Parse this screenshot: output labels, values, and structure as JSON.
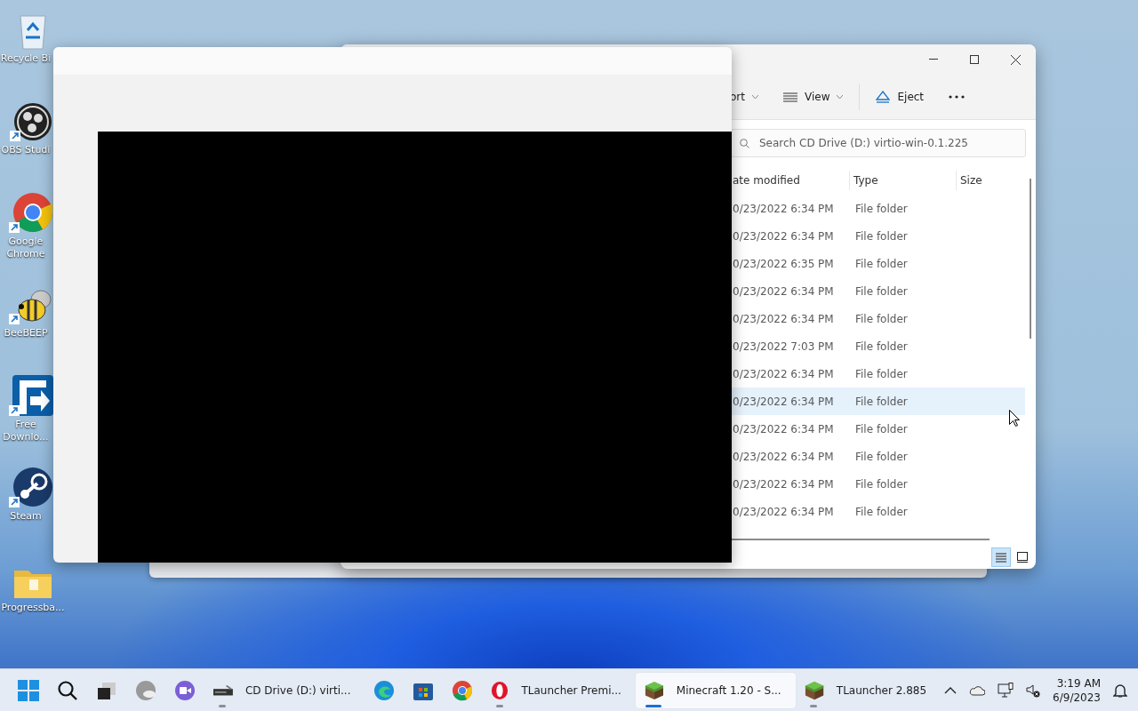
{
  "desktop_icons": [
    {
      "kind": "recycle-bin",
      "label": "Recycle Bi",
      "shortcut": false
    },
    {
      "kind": "obs",
      "label": "OBS Studi",
      "shortcut": true
    },
    {
      "kind": "chrome",
      "label": "Google Chrome",
      "shortcut": true
    },
    {
      "kind": "bee",
      "label": "BeeBEEP",
      "shortcut": true
    },
    {
      "kind": "download",
      "label": "Free Downlo...",
      "shortcut": true
    },
    {
      "kind": "steam",
      "label": "Steam",
      "shortcut": true
    },
    {
      "kind": "folder",
      "label": "Progressba...",
      "shortcut": false
    }
  ],
  "explorer": {
    "toolbar": [
      {
        "kind": "dropdown",
        "label": "ort"
      },
      {
        "kind": "view",
        "label": "View"
      },
      {
        "kind": "eject",
        "label": "Eject"
      },
      {
        "kind": "more"
      }
    ],
    "search": {
      "placeholder": "Search CD Drive (D:) virtio-win-0.1.225"
    },
    "columns": [
      "ate modified",
      "Type",
      "Size"
    ],
    "rows": [
      {
        "date": "0/23/2022 6:34 PM",
        "type": "File folder",
        "highlighted": false
      },
      {
        "date": "0/23/2022 6:34 PM",
        "type": "File folder",
        "highlighted": false
      },
      {
        "date": "0/23/2022 6:35 PM",
        "type": "File folder",
        "highlighted": false
      },
      {
        "date": "0/23/2022 6:34 PM",
        "type": "File folder",
        "highlighted": false
      },
      {
        "date": "0/23/2022 6:34 PM",
        "type": "File folder",
        "highlighted": false
      },
      {
        "date": "0/23/2022 7:03 PM",
        "type": "File folder",
        "highlighted": false
      },
      {
        "date": "0/23/2022 6:34 PM",
        "type": "File folder",
        "highlighted": false
      },
      {
        "date": "0/23/2022 6:34 PM",
        "type": "File folder",
        "highlighted": true
      },
      {
        "date": "0/23/2022 6:34 PM",
        "type": "File folder",
        "highlighted": false
      },
      {
        "date": "0/23/2022 6:34 PM",
        "type": "File folder",
        "highlighted": false
      },
      {
        "date": "0/23/2022 6:34 PM",
        "type": "File folder",
        "highlighted": false
      },
      {
        "date": "0/23/2022 6:34 PM",
        "type": "File folder",
        "highlighted": false
      }
    ],
    "view_buttons": [
      {
        "kind": "details",
        "selected": true
      },
      {
        "kind": "tiles",
        "selected": false
      }
    ]
  },
  "taskbar": {
    "items": [
      {
        "kind": "start",
        "running": false,
        "active": false
      },
      {
        "kind": "search",
        "running": false,
        "active": false
      },
      {
        "kind": "task-view",
        "running": false,
        "active": false
      },
      {
        "kind": "globe",
        "running": false,
        "active": false
      },
      {
        "kind": "meet",
        "running": false,
        "active": false
      },
      {
        "kind": "drive",
        "label": "CD Drive (D:) virti...",
        "running": true,
        "active": false
      },
      {
        "kind": "edge",
        "running": false,
        "active": false
      },
      {
        "kind": "store",
        "running": false,
        "active": false
      },
      {
        "kind": "chrome",
        "running": false,
        "active": false
      },
      {
        "kind": "opera",
        "label": "TLauncher Premi...",
        "running": true,
        "active": false
      },
      {
        "kind": "grass",
        "label": "Minecraft 1.20 - S...",
        "running": true,
        "active": true
      },
      {
        "kind": "grass",
        "label": "TLauncher 2.885",
        "running": true,
        "active": false
      }
    ],
    "time": "3:19 AM",
    "date": "6/9/2023"
  }
}
